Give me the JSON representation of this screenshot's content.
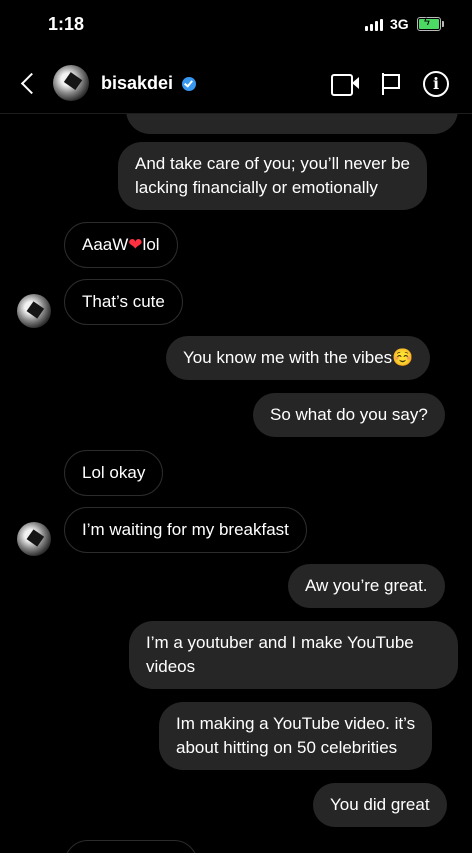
{
  "status_bar": {
    "time": "1:18",
    "network": "3G"
  },
  "header": {
    "username": "bisakdei",
    "verified": true
  },
  "icons": {
    "back": "chevron-left-icon",
    "video": "video-camera-icon",
    "flag": "flag-icon",
    "info": "info-icon",
    "info_glyph": "i"
  },
  "messages": [
    {
      "sender": "me",
      "text_line1": "",
      "text_line2": ""
    },
    {
      "sender": "me",
      "text_line1": "And take care of you; you’ll never be",
      "text_line2": "lacking financially or emotionally"
    },
    {
      "sender": "them",
      "text_before": "AaaW",
      "emoji": "❤",
      "text_after": "lol"
    },
    {
      "sender": "them",
      "text": "That’s cute"
    },
    {
      "sender": "me",
      "text": "You know me with the vibes☺️"
    },
    {
      "sender": "me",
      "text": "So what do you say?"
    },
    {
      "sender": "them",
      "text": "Lol okay"
    },
    {
      "sender": "them",
      "text": "I’m waiting for my breakfast"
    },
    {
      "sender": "me",
      "text": "Aw you’re great."
    },
    {
      "sender": "me",
      "text_line1": "I’m a youtuber and I make YouTube",
      "text_line2": "videos"
    },
    {
      "sender": "me",
      "text_line1": "Im making a YouTube video. it’s",
      "text_line2": "about hitting on 50 celebrities"
    },
    {
      "sender": "me",
      "text": "You did great"
    },
    {
      "sender": "them",
      "text": ""
    }
  ]
}
